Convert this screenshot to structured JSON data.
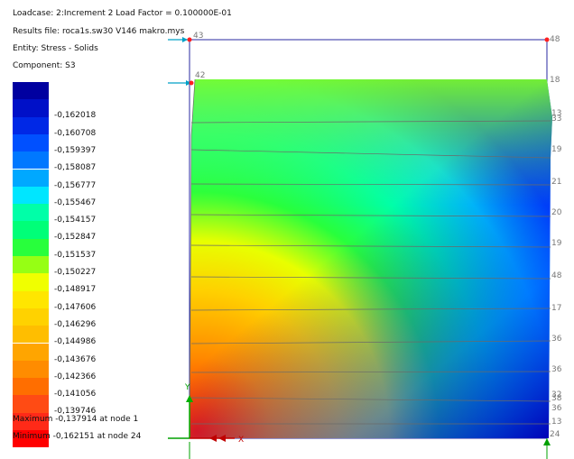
{
  "header": {
    "loadcase": "Loadcase: 2:Increment 2 Load Factor = 0.100000E-01",
    "results_file": "Results file: roca1s.sw30 V146 makro.mys",
    "entity": "Entity: Stress - Solids",
    "component": "Component: S3"
  },
  "legend": {
    "colors": [
      "#0000a0",
      "#0010c8",
      "#0028e6",
      "#0050ff",
      "#0078ff",
      "#00a8ff",
      "#00e6ff",
      "#00ffa8",
      "#00ff78",
      "#28ff3c",
      "#96ff14",
      "#f0ff00",
      "#ffe600",
      "#ffd200",
      "#ffbe00",
      "#ffa500",
      "#ff8c00",
      "#ff6e00",
      "#ff4b14",
      "#ff2a18",
      "#ff0000"
    ],
    "labels": [
      "-0,162018",
      "-0,160708",
      "-0,159397",
      "-0,158087",
      "-0,156777",
      "-0,155467",
      "-0,154157",
      "-0,152847",
      "-0,151537",
      "-0,150227",
      "-0,148917",
      "-0,147606",
      "-0,146296",
      "-0,144986",
      "-0,143676",
      "-0,142366",
      "-0,141056",
      "-0,139746"
    ]
  },
  "footer": {
    "maximum": "Maximum -0,137914 at node 1",
    "minimum": "Minimum -0,162151 at node 24"
  },
  "model": {
    "node_top_left": "43",
    "node_top_right": "48",
    "node_mid_left": "42",
    "node_mid_right": "18",
    "node_bottom_right": "24",
    "right_labels": [
      "13",
      "33",
      "19",
      "21",
      "20",
      "19",
      "48",
      "17",
      "36",
      "36",
      "32",
      "13",
      "38",
      "36"
    ],
    "axis_y": "Y",
    "axis_x": "X"
  }
}
